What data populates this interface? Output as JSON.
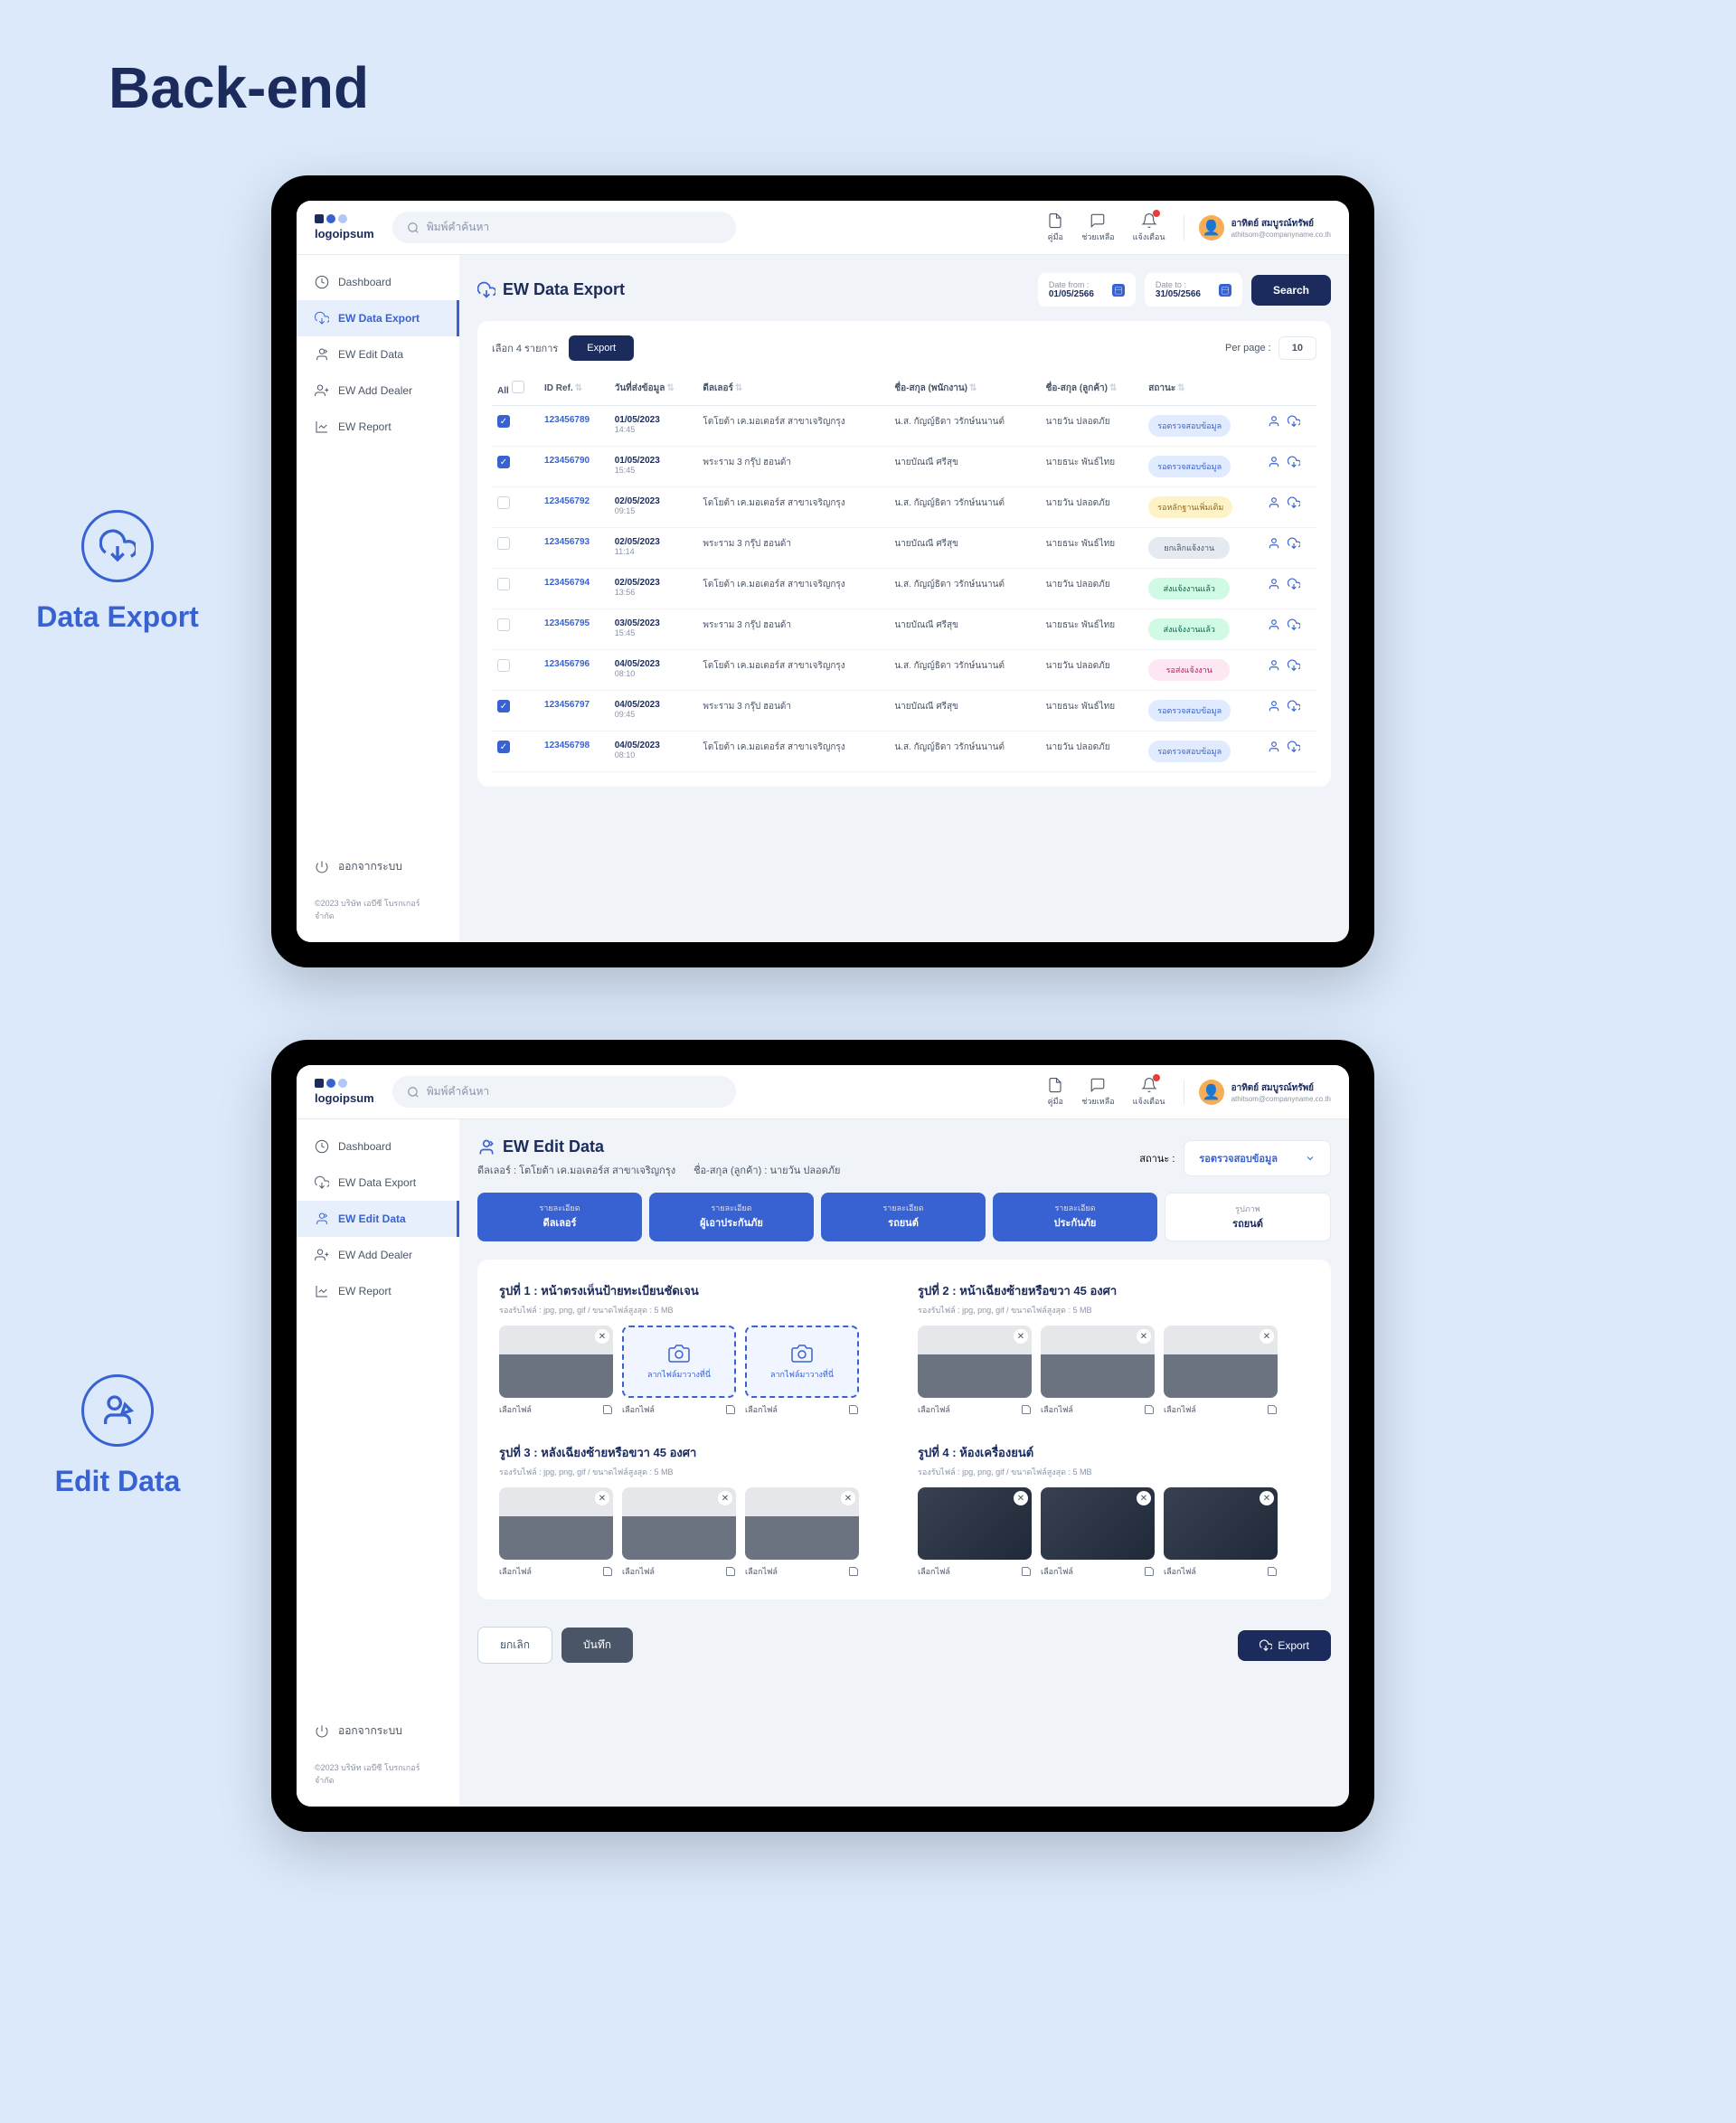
{
  "page_title": "Back-end",
  "sections": [
    {
      "label": "Data Export"
    },
    {
      "label": "Edit Data"
    }
  ],
  "common": {
    "logo": "logoipsum",
    "search_placeholder": "พิมพ์คำค้นหา",
    "top_icons": {
      "guide": "คู่มือ",
      "help": "ช่วยเหลือ",
      "notify": "แจ้งเตือน"
    },
    "user": {
      "name": "อาทิตย์ สมบูรณ์ทรัพย์",
      "email": "athitsom@companyname.co.th"
    },
    "nav": {
      "dashboard": "Dashboard",
      "export": "EW Data Export",
      "edit": "EW Edit Data",
      "dealer": "EW Add Dealer",
      "report": "EW Report",
      "logout": "ออกจากระบบ"
    },
    "footer": "©2023 บริษัท เอบีซี โบรกเกอร์ จำกัด"
  },
  "export_screen": {
    "title": "EW Data Export",
    "date_from_label": "Date from :",
    "date_from": "01/05/2566",
    "date_to_label": "Date to :",
    "date_to": "31/05/2566",
    "search_btn": "Search",
    "selected": "เลือก 4 รายการ",
    "export_btn": "Export",
    "perpage_label": "Per page :",
    "perpage_value": "10",
    "columns": {
      "all": "All",
      "id": "ID Ref.",
      "date": "วันที่ส่งข้อมูล",
      "dealer": "ดีลเลอร์",
      "employee": "ชื่อ-สกุล (พนักงาน)",
      "customer": "ชื่อ-สกุล (ลูกค้า)",
      "status": "สถานะ"
    },
    "rows": [
      {
        "checked": true,
        "id": "123456789",
        "date": "01/05/2023",
        "time": "14:45",
        "dealer": "โตโยต้า เค.มอเตอร์ส\nสาขาเจริญกรุง",
        "employee": "น.ส. กัญญ์ธิดา\nวรักษ์นนานต์",
        "customer": "นายวัน ปลอดภัย",
        "status": "รอตรวจสอบข้อมูล",
        "status_class": "s-blue"
      },
      {
        "checked": true,
        "id": "123456790",
        "date": "01/05/2023",
        "time": "15:45",
        "dealer": "พระราม 3 กรุ๊ป ฮอนด้า",
        "employee": "นายบัณณี ศรีสุข",
        "customer": "นายธนะ พันธ์ไทย",
        "status": "รอตรวจสอบข้อมูล",
        "status_class": "s-blue"
      },
      {
        "checked": false,
        "id": "123456792",
        "date": "02/05/2023",
        "time": "09:15",
        "dealer": "โตโยต้า เค.มอเตอร์ส\nสาขาเจริญกรุง",
        "employee": "น.ส. กัญญ์ธิดา\nวรักษ์นนานต์",
        "customer": "นายวัน ปลอดภัย",
        "status": "รอหลักฐานเพิ่มเติม",
        "status_class": "s-yellow"
      },
      {
        "checked": false,
        "id": "123456793",
        "date": "02/05/2023",
        "time": "11:14",
        "dealer": "พระราม 3 กรุ๊ป ฮอนด้า",
        "employee": "นายบัณณี ศรีสุข",
        "customer": "นายธนะ พันธ์ไทย",
        "status": "ยกเลิกแจ้งงาน",
        "status_class": "s-gray"
      },
      {
        "checked": false,
        "id": "123456794",
        "date": "02/05/2023",
        "time": "13:56",
        "dealer": "โตโยต้า เค.มอเตอร์ส\nสาขาเจริญกรุง",
        "employee": "น.ส. กัญญ์ธิดา\nวรักษ์นนานต์",
        "customer": "นายวัน ปลอดภัย",
        "status": "ส่งแจ้งงานแล้ว",
        "status_class": "s-green"
      },
      {
        "checked": false,
        "id": "123456795",
        "date": "03/05/2023",
        "time": "15:45",
        "dealer": "พระราม 3 กรุ๊ป ฮอนด้า",
        "employee": "นายบัณณี ศรีสุข",
        "customer": "นายธนะ พันธ์ไทย",
        "status": "ส่งแจ้งงานแล้ว",
        "status_class": "s-green"
      },
      {
        "checked": false,
        "id": "123456796",
        "date": "04/05/2023",
        "time": "08:10",
        "dealer": "โตโยต้า เค.มอเตอร์ส\nสาขาเจริญกรุง",
        "employee": "น.ส. กัญญ์ธิดา\nวรักษ์นนานต์",
        "customer": "นายวัน ปลอดภัย",
        "status": "รอส่งแจ้งงาน",
        "status_class": "s-pink"
      },
      {
        "checked": true,
        "id": "123456797",
        "date": "04/05/2023",
        "time": "09:45",
        "dealer": "พระราม 3 กรุ๊ป ฮอนด้า",
        "employee": "นายบัณณี ศรีสุข",
        "customer": "นายธนะ พันธ์ไทย",
        "status": "รอตรวจสอบข้อมูล",
        "status_class": "s-blue"
      },
      {
        "checked": true,
        "id": "123456798",
        "date": "04/05/2023",
        "time": "08:10",
        "dealer": "โตโยต้า เค.มอเตอร์ส\nสาขาเจริญกรุง",
        "employee": "น.ส. กัญญ์ธิดา\nวรักษ์นนานต์",
        "customer": "นายวัน ปลอดภัย",
        "status": "รอตรวจสอบข้อมูล",
        "status_class": "s-blue"
      }
    ]
  },
  "edit_screen": {
    "title": "EW Edit Data",
    "dealer_label": "ดีลเลอร์ :",
    "dealer_value": "โตโยต้า เค.มอเตอร์ส สาขาเจริญกรุง",
    "customer_label": "ชื่อ-สกุล (ลูกค้า) :",
    "customer_value": "นายวัน ปลอดภัย",
    "status_label": "สถานะ :",
    "status_value": "รอตรวจสอบข้อมูล",
    "tabs": [
      {
        "sub": "รายละเอียด",
        "main": "ดีลเลอร์",
        "active": false
      },
      {
        "sub": "รายละเอียด",
        "main": "ผู้เอาประกันภัย",
        "active": false
      },
      {
        "sub": "รายละเอียด",
        "main": "รถยนต์",
        "active": false
      },
      {
        "sub": "รายละเอียด",
        "main": "ประกันภัย",
        "active": false
      },
      {
        "sub": "รูปภาพ",
        "main": "รถยนต์",
        "active": true
      }
    ],
    "hint": "รองรับไฟล์ : jpg, png, gif / ขนาดไฟล์สูงสุด : 5 MB",
    "upload_text": "ลากไฟล์มาวางที่นี่",
    "thumb_label": "เลือกไฟล์",
    "photo_sections": [
      {
        "title": "รูปที่ 1 : หน้าตรงเห็นป้ายทะเบียนชัดเจน",
        "thumbs": [
          "car",
          "upload",
          "upload"
        ]
      },
      {
        "title": "รูปที่ 2 : หน้าเฉียงซ้ายหรือขวา 45 องศา",
        "thumbs": [
          "car",
          "car",
          "car"
        ]
      },
      {
        "title": "รูปที่ 3 : หลังเฉียงซ้ายหรือขวา 45 องศา",
        "thumbs": [
          "car",
          "car",
          "car"
        ]
      },
      {
        "title": "รูปที่ 4 : ห้องเครื่องยนต์",
        "thumbs": [
          "engine",
          "engine",
          "engine"
        ]
      }
    ],
    "cancel_btn": "ยกเลิก",
    "save_btn": "บันทึก",
    "export_btn": "Export"
  }
}
